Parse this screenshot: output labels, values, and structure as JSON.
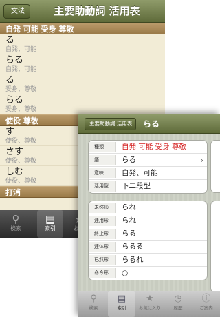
{
  "back_screen": {
    "nav": {
      "back_label": "文法",
      "title": "主要助動詞 活用表"
    },
    "sections": [
      {
        "header": "自発 可能 受身 尊敬",
        "entries": [
          {
            "word": "る",
            "meaning": "自発、可能"
          },
          {
            "word": "らる",
            "meaning": "自発、可能"
          },
          {
            "word": "る",
            "meaning": "受身、尊敬"
          },
          {
            "word": "らる",
            "meaning": "受身、尊敬"
          }
        ]
      },
      {
        "header": "使役 尊敬",
        "entries": [
          {
            "word": "す",
            "meaning": "使役、尊敬"
          },
          {
            "word": "さす",
            "meaning": "使役、尊敬"
          },
          {
            "word": "しむ",
            "meaning": "使役、尊敬"
          }
        ]
      },
      {
        "header": "打消",
        "entries": []
      }
    ],
    "tabs": [
      {
        "label": "検索",
        "icon": "search-icon"
      },
      {
        "label": "索引",
        "icon": "book-icon"
      },
      {
        "label": "お気",
        "icon": "star-icon"
      }
    ]
  },
  "front_screen": {
    "nav": {
      "back_label": "主要助動詞 活用表",
      "title": "らる"
    },
    "info_rows": [
      {
        "label": "種類",
        "value": "自発 可能 受身 尊敬",
        "value_color": "#d42020"
      },
      {
        "label": "語",
        "value": "らる",
        "has_chevron": true
      },
      {
        "label": "意味",
        "value": "自発、可能"
      },
      {
        "label": "活用型",
        "value": "下二段型"
      }
    ],
    "conjugation_rows": [
      {
        "label": "未然形",
        "value": "られ"
      },
      {
        "label": "連用形",
        "value": "られ"
      },
      {
        "label": "終止形",
        "value": "らる"
      },
      {
        "label": "連体形",
        "value": "らるる"
      },
      {
        "label": "已然形",
        "value": "らるれ"
      },
      {
        "label": "命令形",
        "value": "○"
      }
    ],
    "page_dots": {
      "count": 3,
      "current": 2
    },
    "tabs": [
      {
        "label": "検索",
        "icon": "search-icon"
      },
      {
        "label": "索引",
        "icon": "book-icon"
      },
      {
        "label": "お気に入り",
        "icon": "star-icon"
      },
      {
        "label": "履歴",
        "icon": "clock-icon"
      },
      {
        "label": "ご案内",
        "icon": "info-icon"
      }
    ]
  }
}
